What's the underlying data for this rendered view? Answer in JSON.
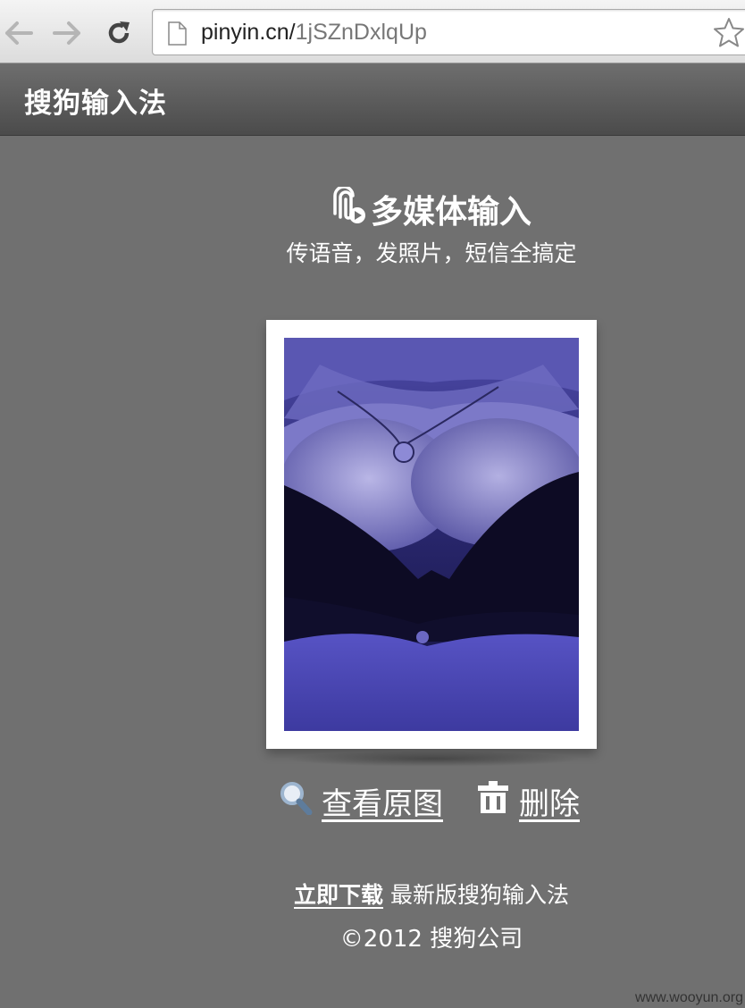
{
  "browser": {
    "url_host": "pinyin.cn/",
    "url_path": "1jSZnDxlqUp",
    "icons": [
      "back-arrow-icon",
      "forward-arrow-icon",
      "reload-icon",
      "page-icon",
      "bookmark-star-icon"
    ]
  },
  "header": {
    "title": "搜狗输入法",
    "bg_color": "#5a5a5a"
  },
  "main": {
    "heading": "多媒体输入",
    "heading_icon": "attachment-play-icon",
    "subtitle": "传语音，发照片，短信全搞定",
    "photo_alt_icon": "photo",
    "actions": {
      "view_label": "查看原图",
      "view_icon": "magnifier-icon",
      "delete_label": "删除",
      "delete_icon": "trash-icon"
    }
  },
  "footer": {
    "download_link": "立即下载",
    "download_text": " 最新版搜狗输入法",
    "copyright": "©2012 搜狗公司",
    "watermark": "www.wooyun.org"
  },
  "colors": {
    "page_bg": "#707070",
    "photo_tint": "#3b3a8a"
  }
}
